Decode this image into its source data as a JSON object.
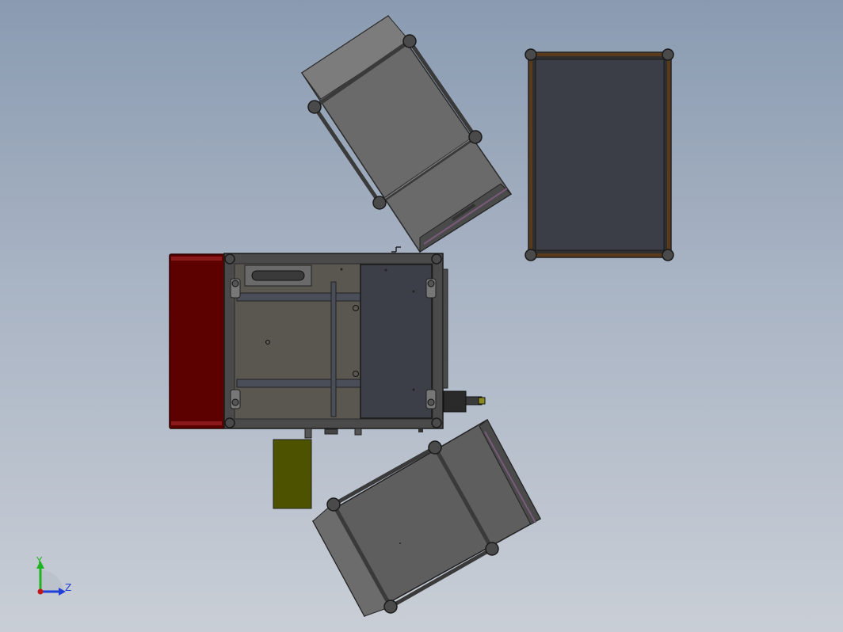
{
  "viewport": {
    "background_top": "#8a9bb1",
    "background_bottom": "#c9ced6"
  },
  "triad": {
    "y_label": "Y",
    "z_label": "Z",
    "y_color": "#1fb31f",
    "z_color": "#1f3fd6",
    "origin_color": "#c01818"
  },
  "colors": {
    "red_part": "#5c0000",
    "olive_part": "#4d5200",
    "dark_panel": "#3c3f47",
    "frame_gray": "#5e5e5e",
    "tray_gray": "#6c6c6c",
    "frame_brown": "#5a3a1c"
  }
}
